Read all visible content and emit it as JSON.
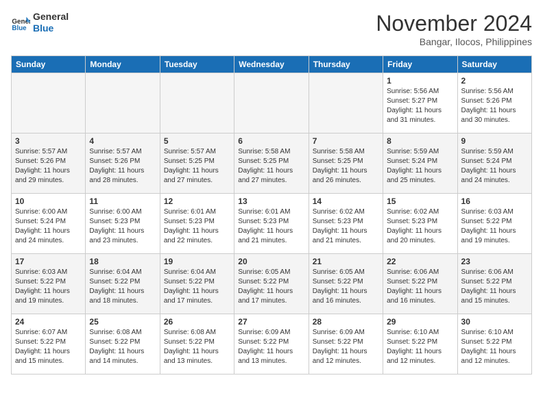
{
  "header": {
    "logo_line1": "General",
    "logo_line2": "Blue",
    "month": "November 2024",
    "location": "Bangar, Ilocos, Philippines"
  },
  "days_of_week": [
    "Sunday",
    "Monday",
    "Tuesday",
    "Wednesday",
    "Thursday",
    "Friday",
    "Saturday"
  ],
  "weeks": [
    [
      {
        "day": "",
        "empty": true
      },
      {
        "day": "",
        "empty": true
      },
      {
        "day": "",
        "empty": true
      },
      {
        "day": "",
        "empty": true
      },
      {
        "day": "",
        "empty": true
      },
      {
        "day": "1",
        "sunrise": "5:56 AM",
        "sunset": "5:27 PM",
        "daylight": "11 hours and 31 minutes."
      },
      {
        "day": "2",
        "sunrise": "5:56 AM",
        "sunset": "5:26 PM",
        "daylight": "11 hours and 30 minutes."
      }
    ],
    [
      {
        "day": "3",
        "sunrise": "5:57 AM",
        "sunset": "5:26 PM",
        "daylight": "11 hours and 29 minutes."
      },
      {
        "day": "4",
        "sunrise": "5:57 AM",
        "sunset": "5:26 PM",
        "daylight": "11 hours and 28 minutes."
      },
      {
        "day": "5",
        "sunrise": "5:57 AM",
        "sunset": "5:25 PM",
        "daylight": "11 hours and 27 minutes."
      },
      {
        "day": "6",
        "sunrise": "5:58 AM",
        "sunset": "5:25 PM",
        "daylight": "11 hours and 27 minutes."
      },
      {
        "day": "7",
        "sunrise": "5:58 AM",
        "sunset": "5:25 PM",
        "daylight": "11 hours and 26 minutes."
      },
      {
        "day": "8",
        "sunrise": "5:59 AM",
        "sunset": "5:24 PM",
        "daylight": "11 hours and 25 minutes."
      },
      {
        "day": "9",
        "sunrise": "5:59 AM",
        "sunset": "5:24 PM",
        "daylight": "11 hours and 24 minutes."
      }
    ],
    [
      {
        "day": "10",
        "sunrise": "6:00 AM",
        "sunset": "5:24 PM",
        "daylight": "11 hours and 24 minutes."
      },
      {
        "day": "11",
        "sunrise": "6:00 AM",
        "sunset": "5:23 PM",
        "daylight": "11 hours and 23 minutes."
      },
      {
        "day": "12",
        "sunrise": "6:01 AM",
        "sunset": "5:23 PM",
        "daylight": "11 hours and 22 minutes."
      },
      {
        "day": "13",
        "sunrise": "6:01 AM",
        "sunset": "5:23 PM",
        "daylight": "11 hours and 21 minutes."
      },
      {
        "day": "14",
        "sunrise": "6:02 AM",
        "sunset": "5:23 PM",
        "daylight": "11 hours and 21 minutes."
      },
      {
        "day": "15",
        "sunrise": "6:02 AM",
        "sunset": "5:23 PM",
        "daylight": "11 hours and 20 minutes."
      },
      {
        "day": "16",
        "sunrise": "6:03 AM",
        "sunset": "5:22 PM",
        "daylight": "11 hours and 19 minutes."
      }
    ],
    [
      {
        "day": "17",
        "sunrise": "6:03 AM",
        "sunset": "5:22 PM",
        "daylight": "11 hours and 19 minutes."
      },
      {
        "day": "18",
        "sunrise": "6:04 AM",
        "sunset": "5:22 PM",
        "daylight": "11 hours and 18 minutes."
      },
      {
        "day": "19",
        "sunrise": "6:04 AM",
        "sunset": "5:22 PM",
        "daylight": "11 hours and 17 minutes."
      },
      {
        "day": "20",
        "sunrise": "6:05 AM",
        "sunset": "5:22 PM",
        "daylight": "11 hours and 17 minutes."
      },
      {
        "day": "21",
        "sunrise": "6:05 AM",
        "sunset": "5:22 PM",
        "daylight": "11 hours and 16 minutes."
      },
      {
        "day": "22",
        "sunrise": "6:06 AM",
        "sunset": "5:22 PM",
        "daylight": "11 hours and 16 minutes."
      },
      {
        "day": "23",
        "sunrise": "6:06 AM",
        "sunset": "5:22 PM",
        "daylight": "11 hours and 15 minutes."
      }
    ],
    [
      {
        "day": "24",
        "sunrise": "6:07 AM",
        "sunset": "5:22 PM",
        "daylight": "11 hours and 15 minutes."
      },
      {
        "day": "25",
        "sunrise": "6:08 AM",
        "sunset": "5:22 PM",
        "daylight": "11 hours and 14 minutes."
      },
      {
        "day": "26",
        "sunrise": "6:08 AM",
        "sunset": "5:22 PM",
        "daylight": "11 hours and 13 minutes."
      },
      {
        "day": "27",
        "sunrise": "6:09 AM",
        "sunset": "5:22 PM",
        "daylight": "11 hours and 13 minutes."
      },
      {
        "day": "28",
        "sunrise": "6:09 AM",
        "sunset": "5:22 PM",
        "daylight": "11 hours and 12 minutes."
      },
      {
        "day": "29",
        "sunrise": "6:10 AM",
        "sunset": "5:22 PM",
        "daylight": "11 hours and 12 minutes."
      },
      {
        "day": "30",
        "sunrise": "6:10 AM",
        "sunset": "5:22 PM",
        "daylight": "11 hours and 12 minutes."
      }
    ]
  ]
}
